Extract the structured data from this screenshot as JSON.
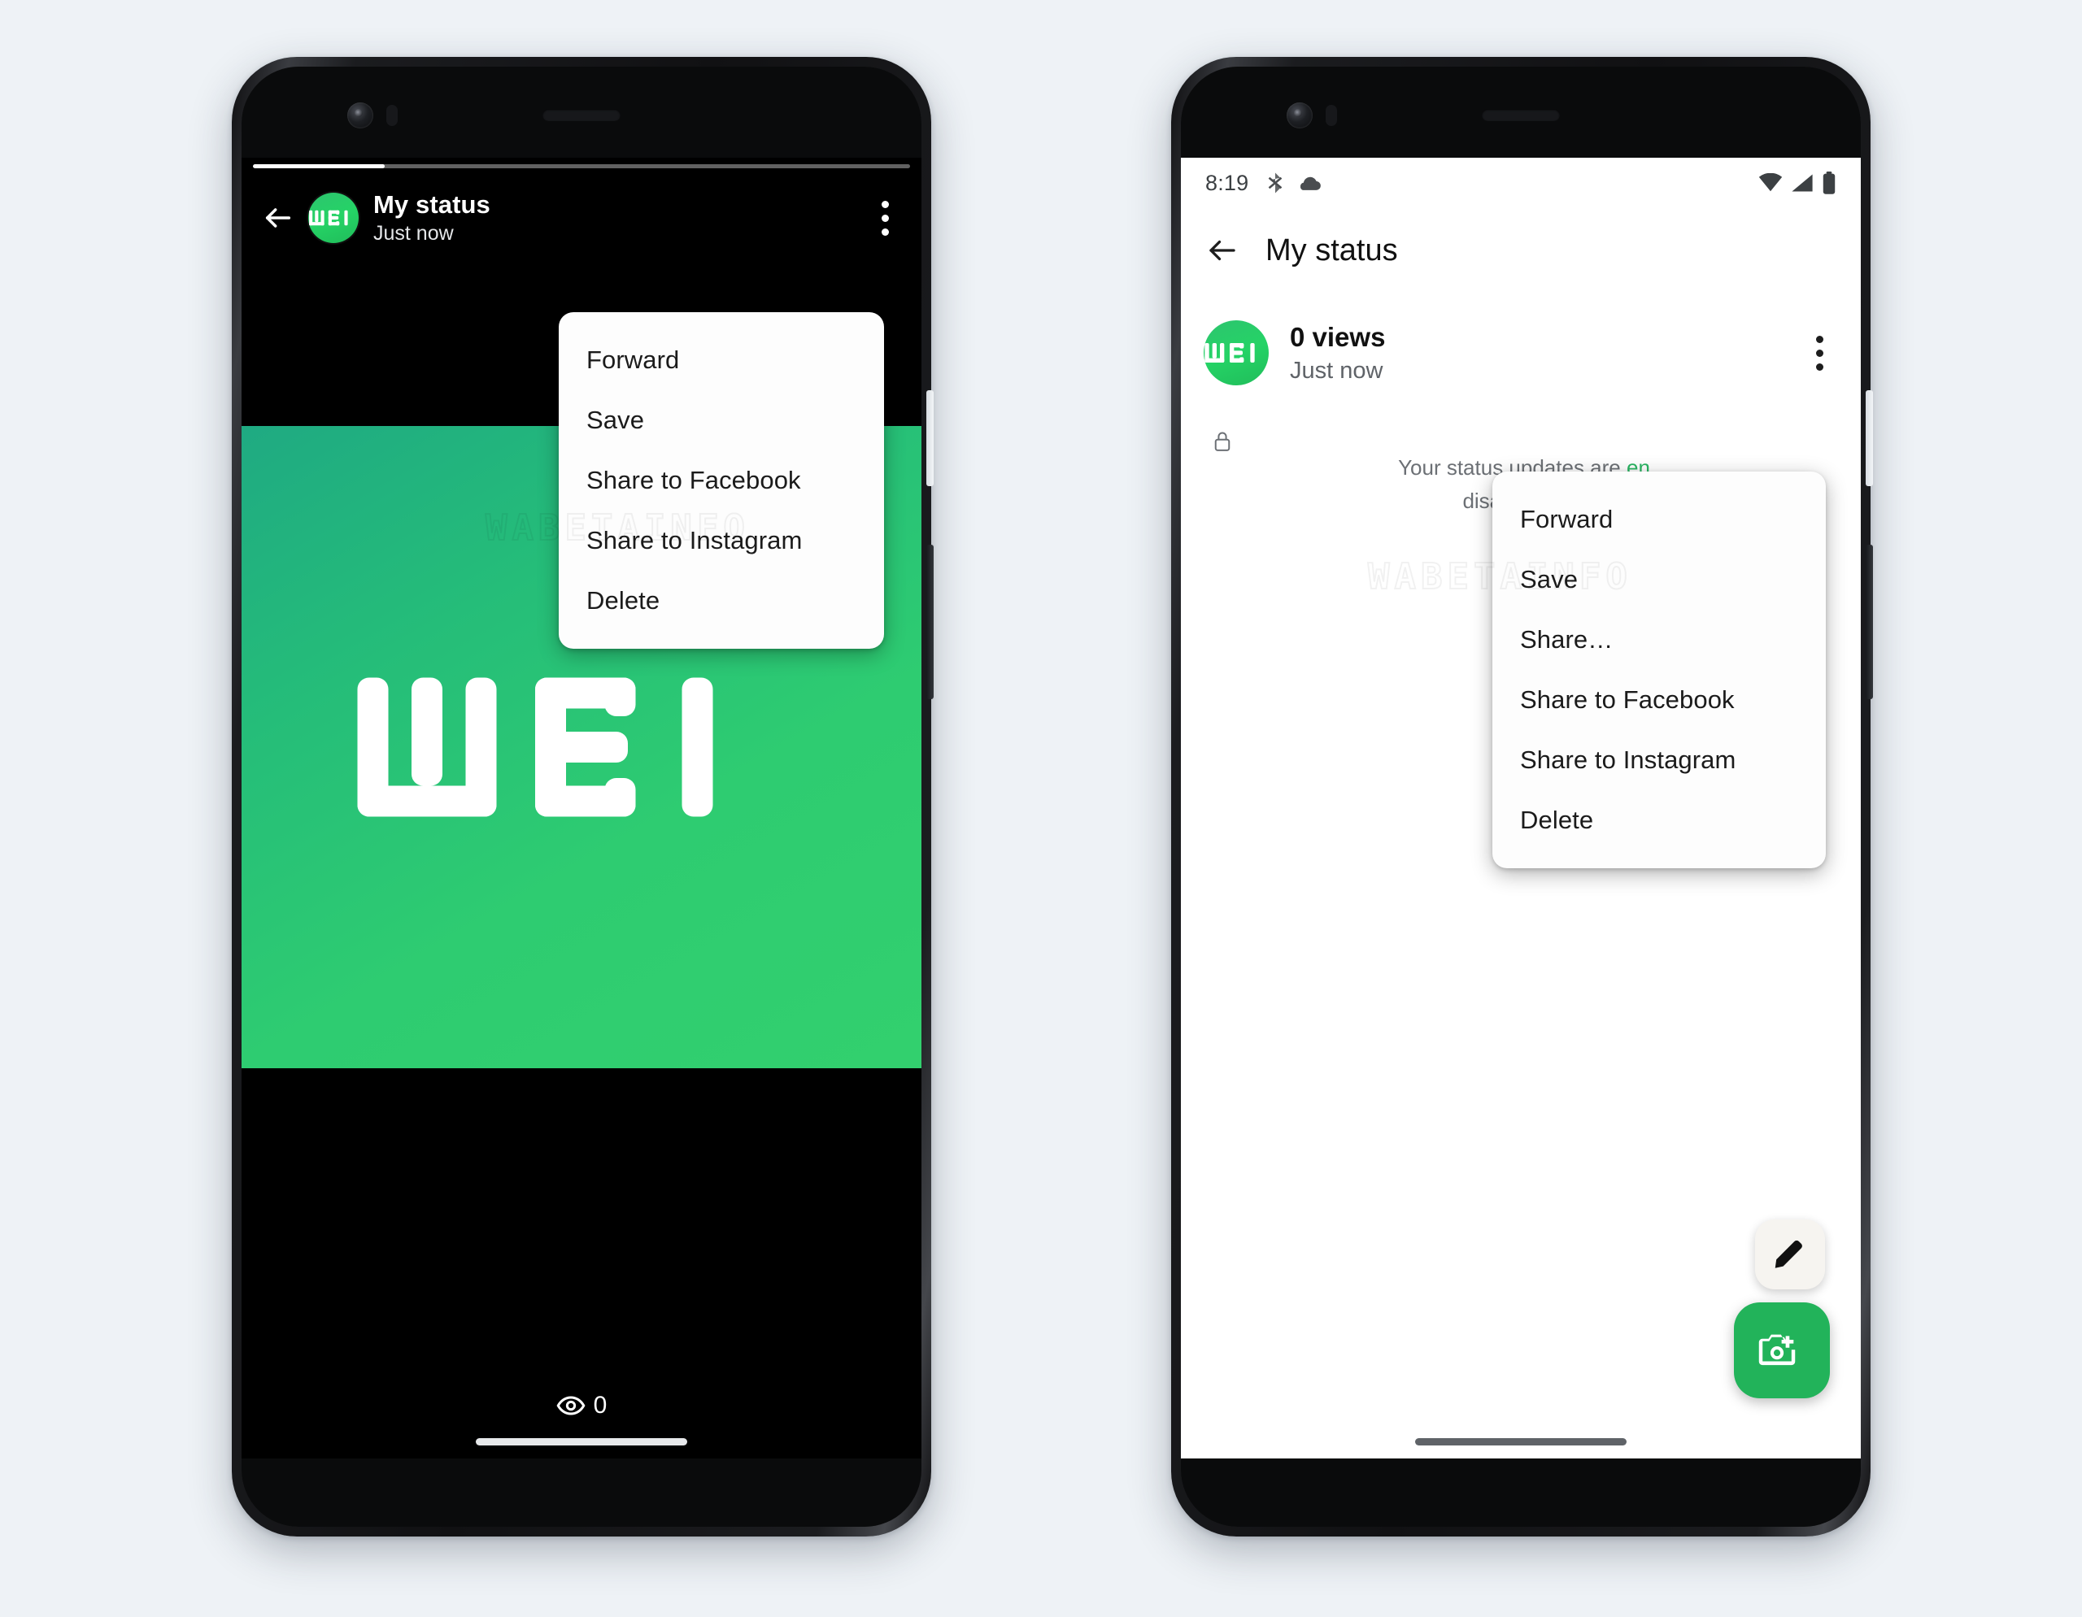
{
  "page": {
    "background_color": "#eef2f6",
    "watermark_text": "WABETAINFO",
    "accent_green": "#25d366",
    "brand_initials": "WBI"
  },
  "left_phone": {
    "screen_mode": "dark",
    "story_progress_percent": 20,
    "topbar": {
      "back_icon": "back-arrow-icon",
      "avatar_label": "WBI",
      "title": "My status",
      "subtitle": "Just now",
      "overflow_icon": "kebab-menu-icon"
    },
    "media": {
      "logo_text": "WBI",
      "gradient_from": "#1faa82",
      "gradient_to": "#32d06e"
    },
    "view_count": {
      "icon": "eye-icon",
      "value": "0"
    },
    "menu": {
      "items": [
        {
          "label": "Forward"
        },
        {
          "label": "Save"
        },
        {
          "label": "Share to Facebook"
        },
        {
          "label": "Share to Instagram"
        },
        {
          "label": "Delete"
        }
      ]
    }
  },
  "right_phone": {
    "screen_mode": "light",
    "status_bar": {
      "clock": "8:19",
      "icons": [
        "bluetooth-off-icon",
        "cloud-icon",
        "wifi-icon",
        "signal-icon",
        "battery-icon"
      ]
    },
    "appbar": {
      "back_icon": "back-arrow-icon",
      "title": "My status"
    },
    "status_row": {
      "avatar_label": "WBI",
      "views": "0 views",
      "time": "Just now",
      "overflow_icon": "kebab-menu-icon"
    },
    "encryption_note": {
      "icon": "lock-icon",
      "line1_before_link": "Your status updates are ",
      "line1_link": "en",
      "line2": "disappear af"
    },
    "fabs": [
      {
        "name": "edit-fab",
        "icon": "pencil-icon",
        "color": "#f6f4f0"
      },
      {
        "name": "camera-fab",
        "icon": "camera-plus-icon",
        "color": "#22b35a"
      }
    ],
    "menu": {
      "items": [
        {
          "label": "Forward"
        },
        {
          "label": "Save"
        },
        {
          "label": "Share…"
        },
        {
          "label": "Share to Facebook"
        },
        {
          "label": "Share to Instagram"
        },
        {
          "label": "Delete"
        }
      ]
    }
  }
}
